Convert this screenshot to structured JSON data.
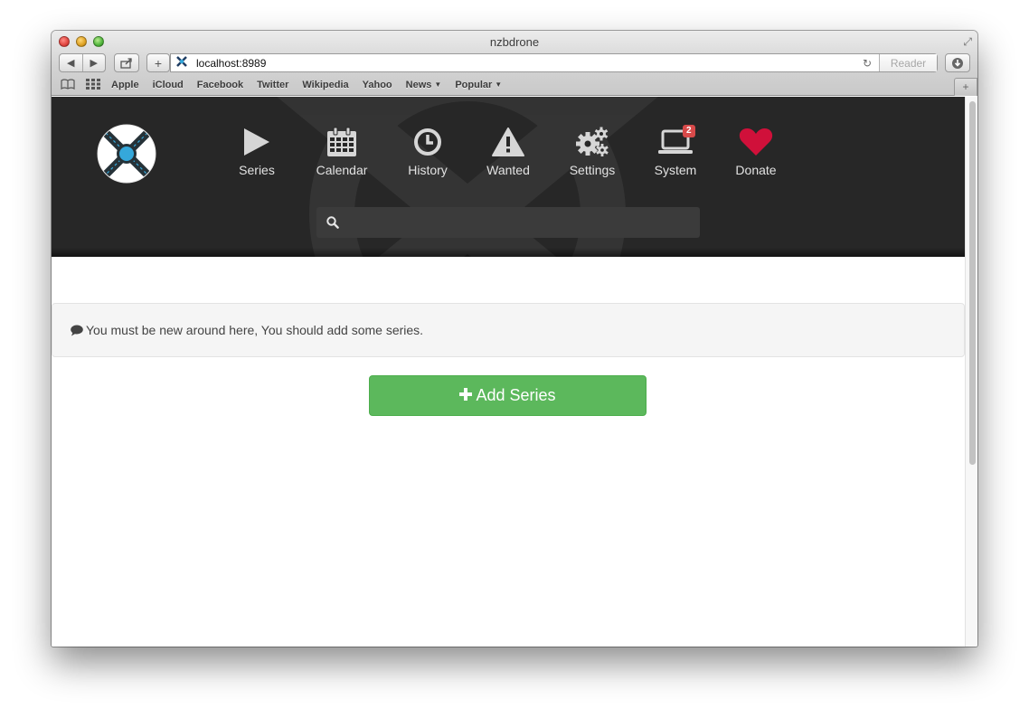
{
  "window": {
    "title": "nzbdrone"
  },
  "toolbar": {
    "back": "◀",
    "forward": "▶",
    "share": "⇪",
    "add": "+",
    "url": "localhost:8989",
    "reader": "Reader",
    "reload": "↻"
  },
  "bookmarks": [
    "Apple",
    "iCloud",
    "Facebook",
    "Twitter",
    "Wikipedia",
    "Yahoo",
    "News",
    "Popular"
  ],
  "nav": {
    "series": "Series",
    "calendar": "Calendar",
    "history": "History",
    "wanted": "Wanted",
    "settings": "Settings",
    "system": "System",
    "system_badge": "2",
    "donate": "Donate"
  },
  "search": {
    "placeholder": ""
  },
  "alert": {
    "text": "You must be new around here, You should add some series."
  },
  "add_series": {
    "label": "Add Series"
  },
  "colors": {
    "header_bg": "#272727",
    "nav_icon": "#d6d6d6",
    "donate_heart": "#d0103a",
    "logo_accent": "#35a8db",
    "add_button": "#5cb85c",
    "badge": "#d84a4a"
  }
}
